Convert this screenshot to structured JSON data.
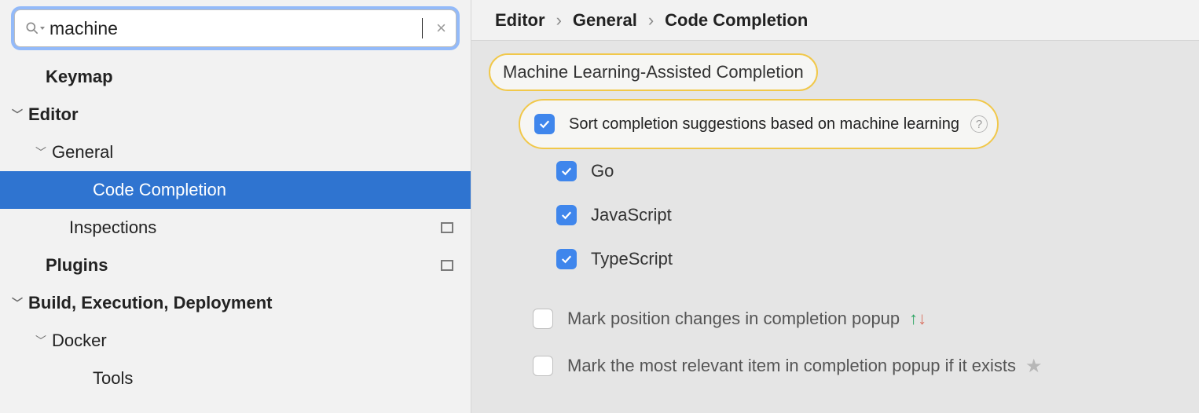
{
  "search": {
    "value": "machine",
    "placeholder": ""
  },
  "sidebar": {
    "items": [
      {
        "label": "Keymap",
        "indent": 58,
        "bold": true,
        "chevron": false,
        "selected": false,
        "badge": false
      },
      {
        "label": "Editor",
        "indent": 32,
        "bold": true,
        "chevron": true,
        "selected": false,
        "badge": false
      },
      {
        "label": "General",
        "indent": 62,
        "bold": false,
        "chevron": true,
        "selected": false,
        "badge": false
      },
      {
        "label": "Code Completion",
        "indent": 118,
        "bold": false,
        "chevron": false,
        "selected": true,
        "badge": false
      },
      {
        "label": "Inspections",
        "indent": 88,
        "bold": false,
        "chevron": false,
        "selected": false,
        "badge": true
      },
      {
        "label": "Plugins",
        "indent": 58,
        "bold": true,
        "chevron": false,
        "selected": false,
        "badge": true
      },
      {
        "label": "Build, Execution, Deployment",
        "indent": 32,
        "bold": true,
        "chevron": true,
        "selected": false,
        "badge": false
      },
      {
        "label": "Docker",
        "indent": 62,
        "bold": false,
        "chevron": true,
        "selected": false,
        "badge": false
      },
      {
        "label": "Tools",
        "indent": 118,
        "bold": false,
        "chevron": false,
        "selected": false,
        "badge": false
      }
    ]
  },
  "breadcrumb": {
    "a": "Editor",
    "b": "General",
    "c": "Code Completion"
  },
  "section": {
    "title": "Machine Learning-Assisted Completion",
    "main_option": "Sort completion suggestions based on machine learning",
    "langs": [
      {
        "label": "Go",
        "checked": true
      },
      {
        "label": "JavaScript",
        "checked": true
      },
      {
        "label": "TypeScript",
        "checked": true
      }
    ],
    "opt_mark_position": "Mark position changes in completion popup",
    "opt_mark_relevant": "Mark the most relevant item in completion popup if it exists"
  }
}
